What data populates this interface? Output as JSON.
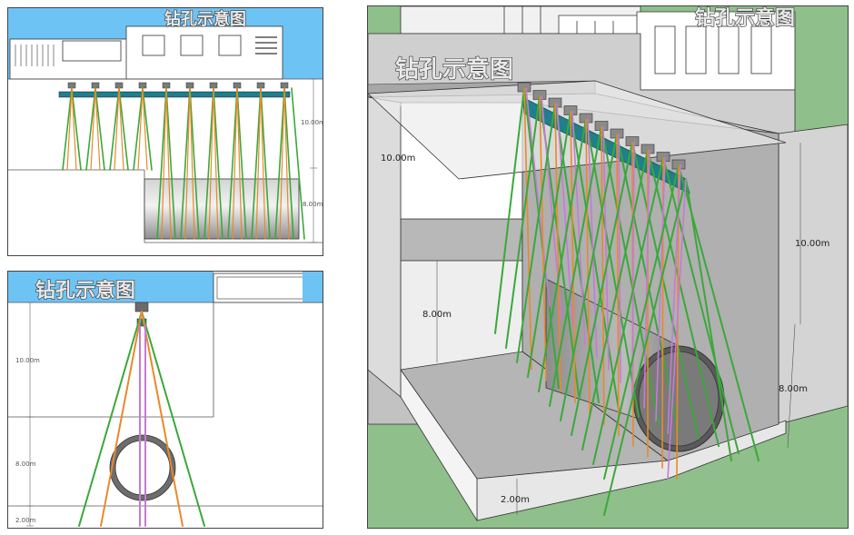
{
  "title": "钻孔示意图",
  "panels": {
    "front": {
      "dims": [
        "10.00m",
        "8.00m"
      ]
    },
    "side": {
      "title": "钻孔示意图",
      "dims": [
        "10.00m",
        "8.00m",
        "2.00m"
      ]
    },
    "perspective": {
      "title": "钻孔示意图",
      "dims": [
        "10.00m",
        "8.00m",
        "10.00m",
        "8.00m",
        "2.00m"
      ]
    }
  },
  "colors": {
    "sky": "#6ec3f5",
    "ground": "#8fbf8a",
    "rod_green": "#3aa83a",
    "rod_orange": "#e8892b",
    "rod_purple": "#c67ad6",
    "beam_teal": "#1f7f8a",
    "tunnel_grey": "#a9a9a9"
  }
}
